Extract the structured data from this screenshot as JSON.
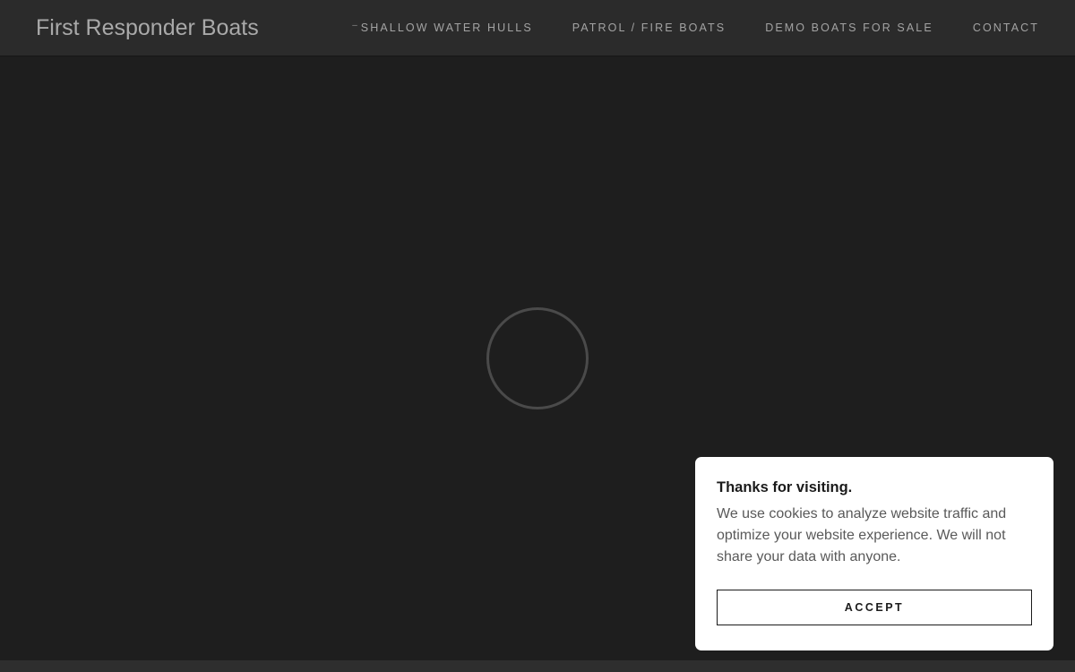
{
  "header": {
    "site_title": "First Responder Boats",
    "nav": [
      {
        "label": "Shallow Water Hulls",
        "has_dropdown_dash": true
      },
      {
        "label": "Patrol / Fire Boats"
      },
      {
        "label": "Demo Boats for Sale"
      },
      {
        "label": "Contact"
      }
    ]
  },
  "hero": {
    "state": "loading",
    "spinner_icon": "loading-ring-icon"
  },
  "cookie_banner": {
    "title": "Thanks for visiting.",
    "body": "We use cookies to analyze website traffic and optimize your website experience. We will not share your data with anyone.",
    "accept_label": "Accept"
  },
  "colors": {
    "page_background": "#1e1e1e",
    "header_background": "#2b2b2b",
    "text_muted": "#a9a9a9",
    "banner_background": "#ffffff",
    "banner_text": "#1b1b1b"
  }
}
